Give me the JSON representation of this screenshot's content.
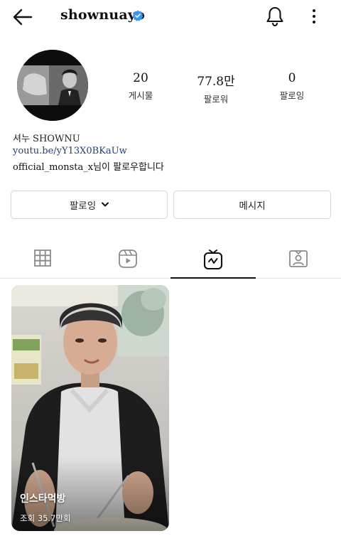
{
  "header": {
    "username": "shownuayo",
    "icons": [
      "back-arrow-icon",
      "verified-badge-icon",
      "bell-icon",
      "more-vertical-icon"
    ],
    "verified_color": "#3897f0"
  },
  "profile": {
    "stats": [
      {
        "value": "20",
        "label": "게시물"
      },
      {
        "value": "77.8만",
        "label": "팔로워"
      },
      {
        "value": "0",
        "label": "팔로잉"
      }
    ],
    "bio": {
      "name": "셔누 SHOWNU",
      "link": "youtu.be/yY13X0BKaUw",
      "followed_by": "official_monsta_x님이 팔로우합니다"
    }
  },
  "actions": {
    "follow_label": "팔로잉",
    "message_label": "메시지"
  },
  "tabs": {
    "items": [
      "grid-icon",
      "reels-icon",
      "igtv-icon",
      "tagged-icon"
    ],
    "active_index": 2
  },
  "videos": [
    {
      "title": "인스타먹방",
      "views": "조회 35.7만회"
    }
  ],
  "colors": {
    "link": "#1e3f74",
    "border": "#d6d6d6"
  }
}
